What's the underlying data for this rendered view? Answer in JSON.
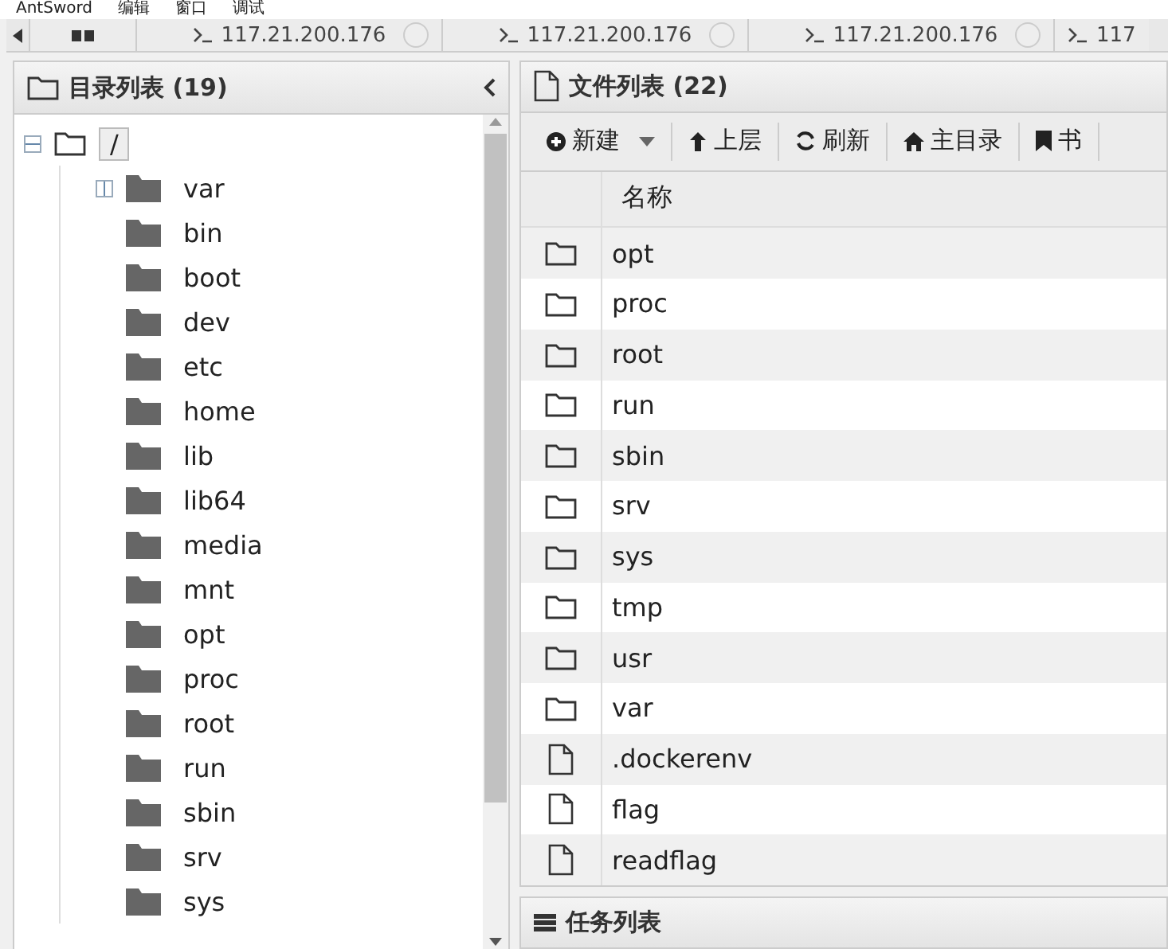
{
  "menu": [
    "AntSword",
    "编辑",
    "窗口",
    "调试"
  ],
  "tabs": [
    {
      "kind": "home"
    },
    {
      "kind": "shell",
      "label": "117.21.200.176"
    },
    {
      "kind": "shell",
      "label": "117.21.200.176"
    },
    {
      "kind": "shell",
      "label": "117.21.200.176"
    },
    {
      "kind": "shell",
      "label": "117"
    }
  ],
  "dir_panel": {
    "title": "目录列表 (19)",
    "root": {
      "label": "/",
      "expanded": true,
      "children": [
        {
          "label": "var",
          "expandable": true
        },
        {
          "label": "bin",
          "expandable": false
        },
        {
          "label": "boot",
          "expandable": false
        },
        {
          "label": "dev",
          "expandable": false
        },
        {
          "label": "etc",
          "expandable": false
        },
        {
          "label": "home",
          "expandable": false
        },
        {
          "label": "lib",
          "expandable": false
        },
        {
          "label": "lib64",
          "expandable": false
        },
        {
          "label": "media",
          "expandable": false
        },
        {
          "label": "mnt",
          "expandable": false
        },
        {
          "label": "opt",
          "expandable": false
        },
        {
          "label": "proc",
          "expandable": false
        },
        {
          "label": "root",
          "expandable": false
        },
        {
          "label": "run",
          "expandable": false
        },
        {
          "label": "sbin",
          "expandable": false
        },
        {
          "label": "srv",
          "expandable": false
        },
        {
          "label": "sys",
          "expandable": false
        }
      ]
    }
  },
  "file_panel": {
    "title": "文件列表 (22)",
    "toolbar": [
      {
        "kind": "new",
        "label": "新建",
        "dropdown": true
      },
      {
        "kind": "up",
        "label": "上层",
        "dropdown": false
      },
      {
        "kind": "refresh",
        "label": "刷新",
        "dropdown": false
      },
      {
        "kind": "home",
        "label": "主目录",
        "dropdown": false
      },
      {
        "kind": "bookmark",
        "label": "书",
        "dropdown": false
      }
    ],
    "columns": [
      "名称"
    ],
    "rows": [
      {
        "kind": "folder",
        "name": "opt"
      },
      {
        "kind": "folder",
        "name": "proc"
      },
      {
        "kind": "folder",
        "name": "root"
      },
      {
        "kind": "folder",
        "name": "run"
      },
      {
        "kind": "folder",
        "name": "sbin"
      },
      {
        "kind": "folder",
        "name": "srv"
      },
      {
        "kind": "folder",
        "name": "sys"
      },
      {
        "kind": "folder",
        "name": "tmp"
      },
      {
        "kind": "folder",
        "name": "usr"
      },
      {
        "kind": "folder",
        "name": "var"
      },
      {
        "kind": "file",
        "name": ".dockerenv"
      },
      {
        "kind": "file",
        "name": "flag"
      },
      {
        "kind": "file",
        "name": "readflag"
      }
    ]
  },
  "task_panel": {
    "title": "任务列表"
  }
}
